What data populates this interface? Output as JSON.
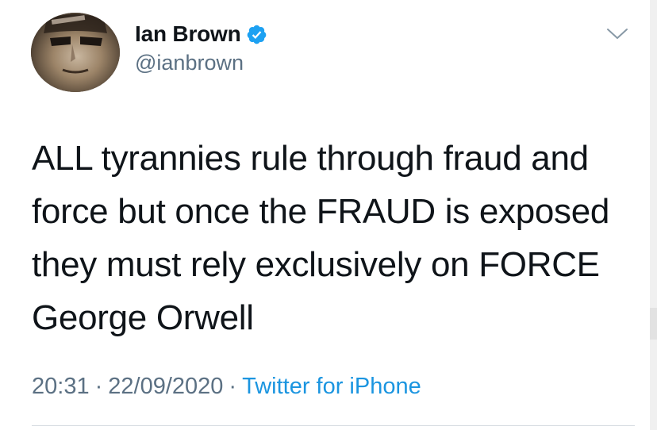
{
  "author": {
    "display_name": "Ian Brown",
    "handle": "@ianbrown",
    "avatar_icon": "user-avatar",
    "verified_icon": "verified-badge-icon",
    "verified_color": "#1da1f2"
  },
  "menu": {
    "icon": "chevron-down-icon"
  },
  "tweet": {
    "lines": [
      "ALL tyrannies rule through fraud and",
      "force but once the FRAUD is exposed",
      "they must rely exclusively on FORCE",
      "George Orwell"
    ]
  },
  "meta": {
    "time": "20:31",
    "separator": "·",
    "date": "22/09/2020",
    "source": "Twitter for iPhone",
    "source_color": "#1b95e0"
  }
}
